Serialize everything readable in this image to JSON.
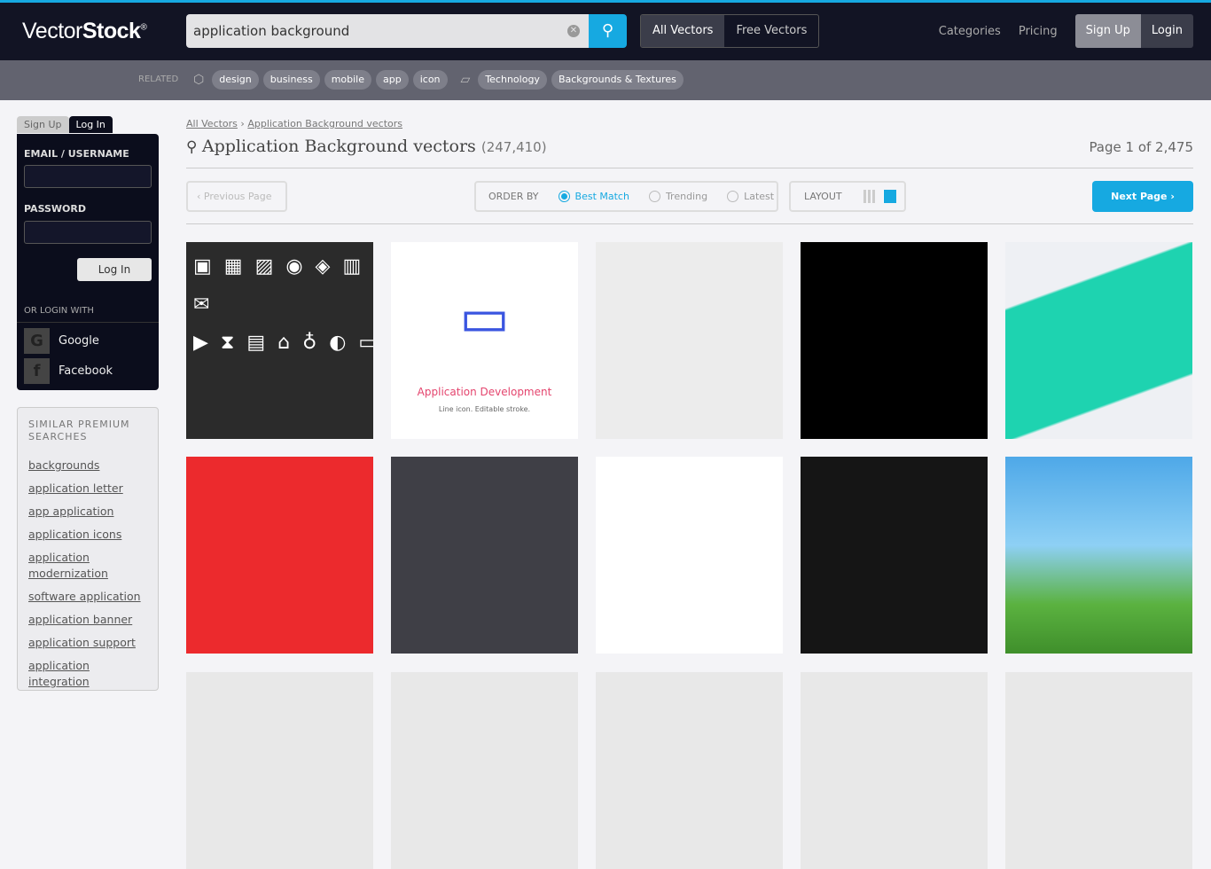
{
  "header": {
    "logo": "VectorStock",
    "search_value": "application background",
    "toggle": [
      "All Vectors",
      "Free Vectors"
    ],
    "nav": [
      "Categories",
      "Pricing"
    ],
    "signup": "Sign Up",
    "login": "Login"
  },
  "related": {
    "label": "RELATED",
    "tags": [
      "design",
      "business",
      "mobile",
      "app",
      "icon"
    ],
    "categories": [
      "Technology",
      "Backgrounds & Textures"
    ]
  },
  "sidebar": {
    "tabs": [
      "Sign Up",
      "Log In"
    ],
    "email_label": "EMAIL / USERNAME",
    "password_label": "PASSWORD",
    "login_button": "Log In",
    "or_login": "OR LOGIN WITH",
    "social": [
      "Google",
      "Facebook"
    ],
    "similar_title": "SIMILAR PREMIUM SEARCHES",
    "similar": [
      "backgrounds",
      "application letter",
      "app application",
      "application icons",
      "application modernization",
      "software application",
      "application banner",
      "application support",
      "application integration"
    ]
  },
  "main": {
    "breadcrumbs": [
      "All Vectors",
      "Application Background vectors"
    ],
    "title": "Application Background vectors",
    "count": "(247,410)",
    "page_info": "Page 1 of 2,475",
    "prev": "Previous Page",
    "next": "Next Page",
    "order_label": "ORDER BY",
    "order_options": [
      "Best Match",
      "Trending",
      "Latest"
    ],
    "selected_order": "Best Match",
    "layout_label": "LAYOUT",
    "tile2_title": "Application Development",
    "tile2_sub": "Line icon. Editable stroke.",
    "tile_colors": [
      "#2b2b2b",
      "#ffffff",
      "#ececec",
      "#000000",
      "#eef0f4",
      "#ec2a2d",
      "#3f3f46",
      "#ffffff",
      "#151515",
      "#3e9be0"
    ]
  },
  "colors": {
    "accent": "#16a9e1",
    "header": "#121424"
  }
}
